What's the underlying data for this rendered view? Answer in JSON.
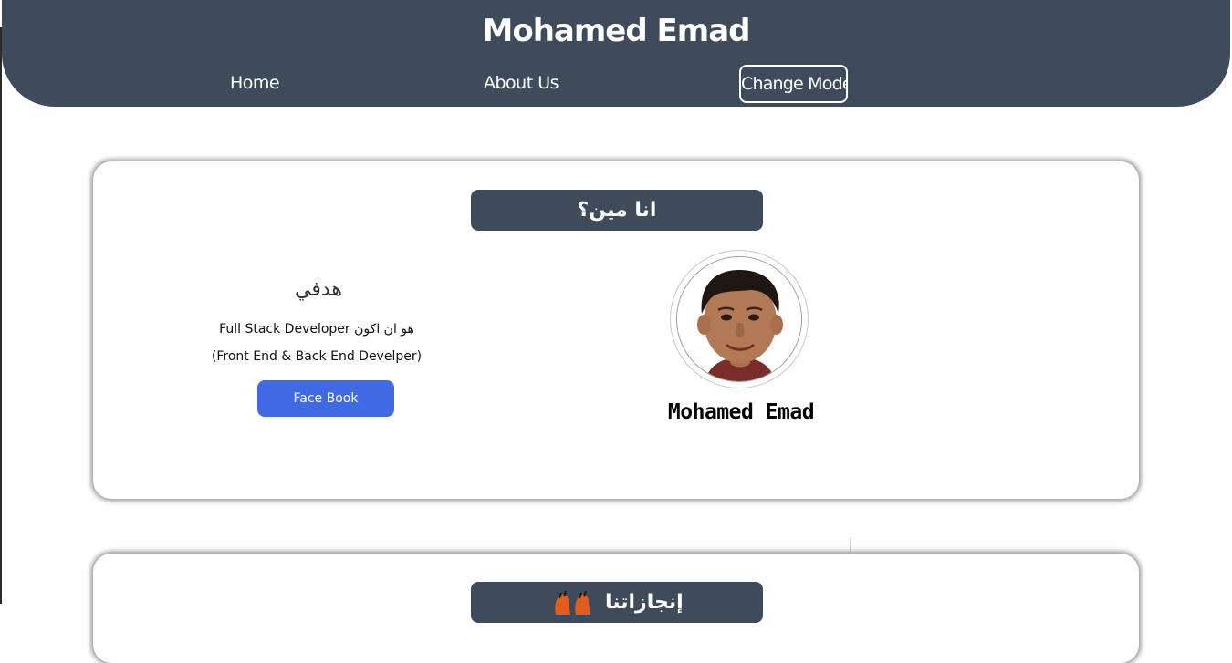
{
  "header": {
    "title": "Mohamed Emad",
    "nav": {
      "home": "Home",
      "about": "About Us",
      "change_mode": "Change Mode"
    }
  },
  "about_section": {
    "title": "انا مين؟",
    "goal_heading": "هدفي",
    "goal_line1": "هو ان اكون Full Stack Developer",
    "goal_line2": "(Front End & Back End Develper)",
    "facebook_button": "Face Book",
    "profile_name": "Mohamed  Emad",
    "avatar_alt": "profile-photo"
  },
  "achievements_section": {
    "title": "إنجازاتنا"
  },
  "colors": {
    "header_bg": "#3e4b5b",
    "button_blue": "#4169e1",
    "page_bg": "#ffffff"
  },
  "icons": {
    "achievements": "hands-raised-icon"
  }
}
